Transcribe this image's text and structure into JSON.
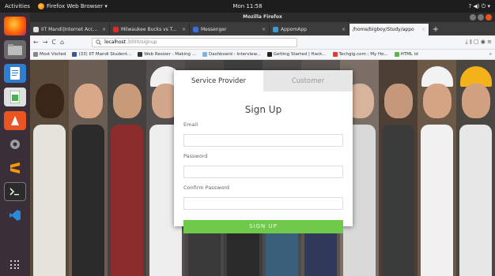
{
  "topbar": {
    "activities": "Activities",
    "app_menu": "Firefox Web Browser ▾",
    "clock": "Mon 11:58",
    "tray": "? ◀) ⏻ ▾"
  },
  "window": {
    "title": "Mozilla Firefox"
  },
  "tabs": [
    {
      "label": "IIT Mandi|Internet Access",
      "icon_color": "#dddddd",
      "close": "×"
    },
    {
      "label": "Milwaukee Bucks vs Toro",
      "icon_color": "#e8261f",
      "close": "×"
    },
    {
      "label": "Messenger",
      "icon_color": "#3b6fd8",
      "close": "×"
    },
    {
      "label": "AppomApp",
      "icon_color": "#3d9ad6",
      "close": "×"
    },
    {
      "label": "/home/bigboy/Study/appo",
      "icon_color": "#ffffff",
      "close": "×",
      "active": true
    }
  ],
  "newtab": "+",
  "nav": {
    "back": "←",
    "forward": "→",
    "reload": "C",
    "home": "⌂",
    "url_host": "localhost",
    "url_path": ":3000/signup",
    "right_icons": "⤓  ⫴  ▢  ◉  ≡"
  },
  "bookmarks": [
    {
      "label": "Most Visited",
      "icon_color": "#888888"
    },
    {
      "label": "(33) IIT Mandi Student...",
      "icon_color": "#3b5998"
    },
    {
      "label": "Web Resizer - Making ...",
      "icon_color": "#333333"
    },
    {
      "label": "Dashboard - Interview...",
      "icon_color": "#7fb3e0"
    },
    {
      "label": "Getting Started | Hack...",
      "icon_color": "#222222"
    },
    {
      "label": "Techgig.com : My Ho...",
      "icon_color": "#e03a3a"
    },
    {
      "label": "HTML id",
      "icon_color": "#5fb44b"
    }
  ],
  "bookmarks_more": "»",
  "signup": {
    "tab_service_provider": "Service Provider",
    "tab_customer": "Customer",
    "title": "Sign Up",
    "email_label": "Email",
    "email_value": "",
    "password_label": "Password",
    "password_value": "",
    "confirm_label": "Confirm Password",
    "confirm_value": "",
    "button": "SIGN UP"
  },
  "colors": {
    "accent_green": "#6fc94a",
    "ubuntu_orange": "#e95420"
  }
}
